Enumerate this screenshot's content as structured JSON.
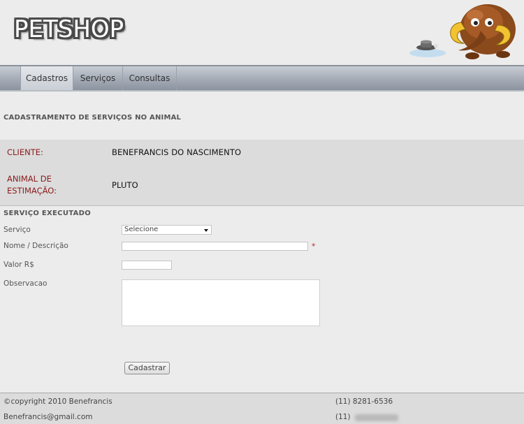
{
  "header": {
    "logo_text": "PETSHOP",
    "mascot_icon": "mammoth-mascot-icon"
  },
  "nav": {
    "items": [
      {
        "label": "Cadastros",
        "active": true
      },
      {
        "label": "Serviços",
        "active": false
      },
      {
        "label": "Consultas",
        "active": false
      }
    ]
  },
  "page": {
    "title": "CADASTRAMENTO DE SERVIÇOS NO ANIMAL"
  },
  "info": {
    "cliente_label": "CLIENTE:",
    "cliente_value": "BENEFRANCIS DO NASCIMENTO",
    "animal_label_line1": "ANIMAL DE",
    "animal_label_line2": "ESTIMAÇÃO:",
    "animal_value": "PLUTO"
  },
  "form": {
    "section_title": "SERVIÇO EXECUTADO",
    "servico_label": "Serviço",
    "servico_selected": "Selecione",
    "nome_label": "Nome / Descrição",
    "nome_value": "",
    "required_mark": "*",
    "valor_label": "Valor R$",
    "valor_value": "",
    "obs_label": "Observacao",
    "obs_value": "",
    "submit_label": "Cadastrar"
  },
  "footer": {
    "copyright": "©copyright 2010 Benefrancis",
    "email": "Benefrancis@gmail.com",
    "phone1": "(11) 8281-6536",
    "phone2_prefix": "(11)"
  },
  "colors": {
    "label_red": "#8b1a1a",
    "nav_gradient_top": "#c7ccd3",
    "nav_gradient_bottom": "#8b939f",
    "panel_bg": "#dcdcdc",
    "page_bg": "#ececec"
  }
}
